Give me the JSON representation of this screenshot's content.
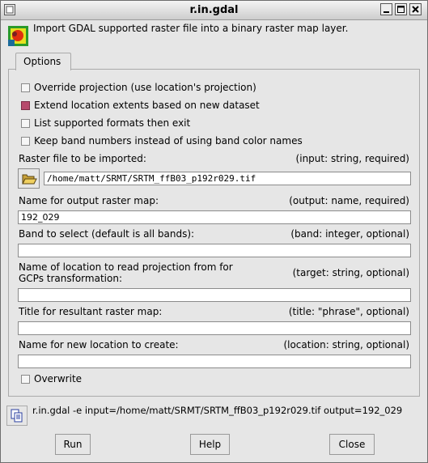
{
  "window": {
    "title": "r.in.gdal"
  },
  "description": "Import GDAL supported raster file into a binary raster map layer.",
  "tabs": [
    {
      "label": "Options"
    }
  ],
  "flags": [
    {
      "label": "Override projection (use location's projection)",
      "checked": false
    },
    {
      "label": "Extend location extents based on new dataset",
      "checked": true
    },
    {
      "label": "List supported formats then exit",
      "checked": false
    },
    {
      "label": "Keep band numbers instead of using band color names",
      "checked": false
    }
  ],
  "params": {
    "input": {
      "label": "Raster file to be imported:",
      "type": "(input:  string, required)",
      "value": "/home/matt/SRMT/SRTM_ffB03_p192r029.tif"
    },
    "output": {
      "label": "Name for output raster map:",
      "type": "(output:  name, required)",
      "value": "192_029"
    },
    "band": {
      "label": "Band to select (default is all bands):",
      "type": "(band:  integer, optional)",
      "value": ""
    },
    "target": {
      "label": "Name of location to read projection from for GCPs transformation:",
      "type": "(target:  string, optional)",
      "value": ""
    },
    "title": {
      "label": "Title for resultant raster map:",
      "type": "(title:  \"phrase\", optional)",
      "value": ""
    },
    "location": {
      "label": "Name for new location to create:",
      "type": "(location:  string, optional)",
      "value": ""
    }
  },
  "overwrite": {
    "label": "Overwrite",
    "checked": false
  },
  "command": "r.in.gdal -e input=/home/matt/SRMT/SRTM_ffB03_p192r029.tif output=192_029",
  "buttons": {
    "run": "Run",
    "help": "Help",
    "close": "Close"
  }
}
